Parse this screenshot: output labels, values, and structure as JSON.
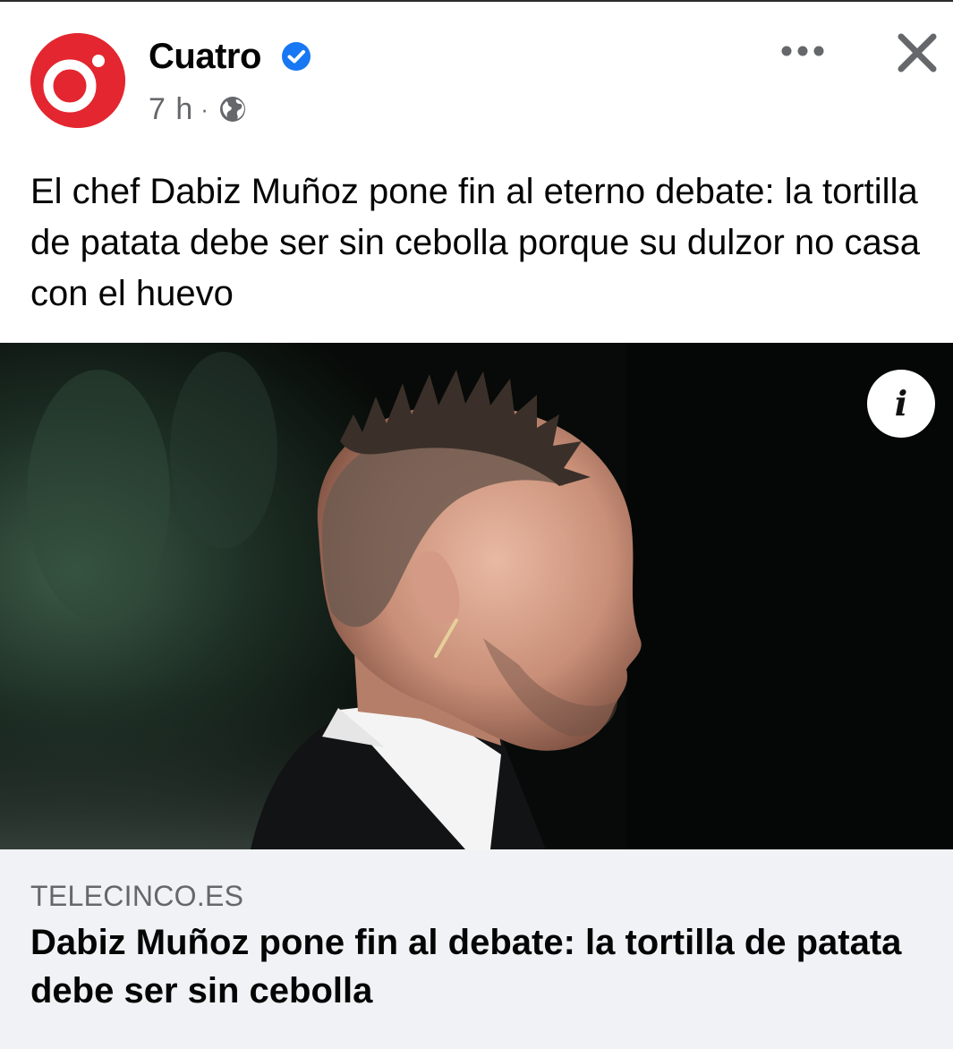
{
  "post": {
    "page_name": "Cuatro",
    "time": "7 h",
    "separator": "·",
    "privacy_icon": "globe-icon",
    "verified_icon": "verified-badge-icon",
    "more_icon": "more-options-icon",
    "close_icon": "close-icon",
    "text": "El chef Dabiz Muñoz pone fin al eterno debate: la tortilla de patata debe ser sin cebolla porque su dulzor no casa con el huevo"
  },
  "image": {
    "info_label": "i"
  },
  "link_preview": {
    "domain": "TELECINCO.ES",
    "title": "Dabiz Muñoz pone fin al debate: la tortilla de patata debe ser sin cebolla"
  },
  "colors": {
    "brand_red": "#e3262f",
    "verified_blue": "#1877f2",
    "secondary_text": "#65676b",
    "link_bg": "#f0f2f5"
  }
}
